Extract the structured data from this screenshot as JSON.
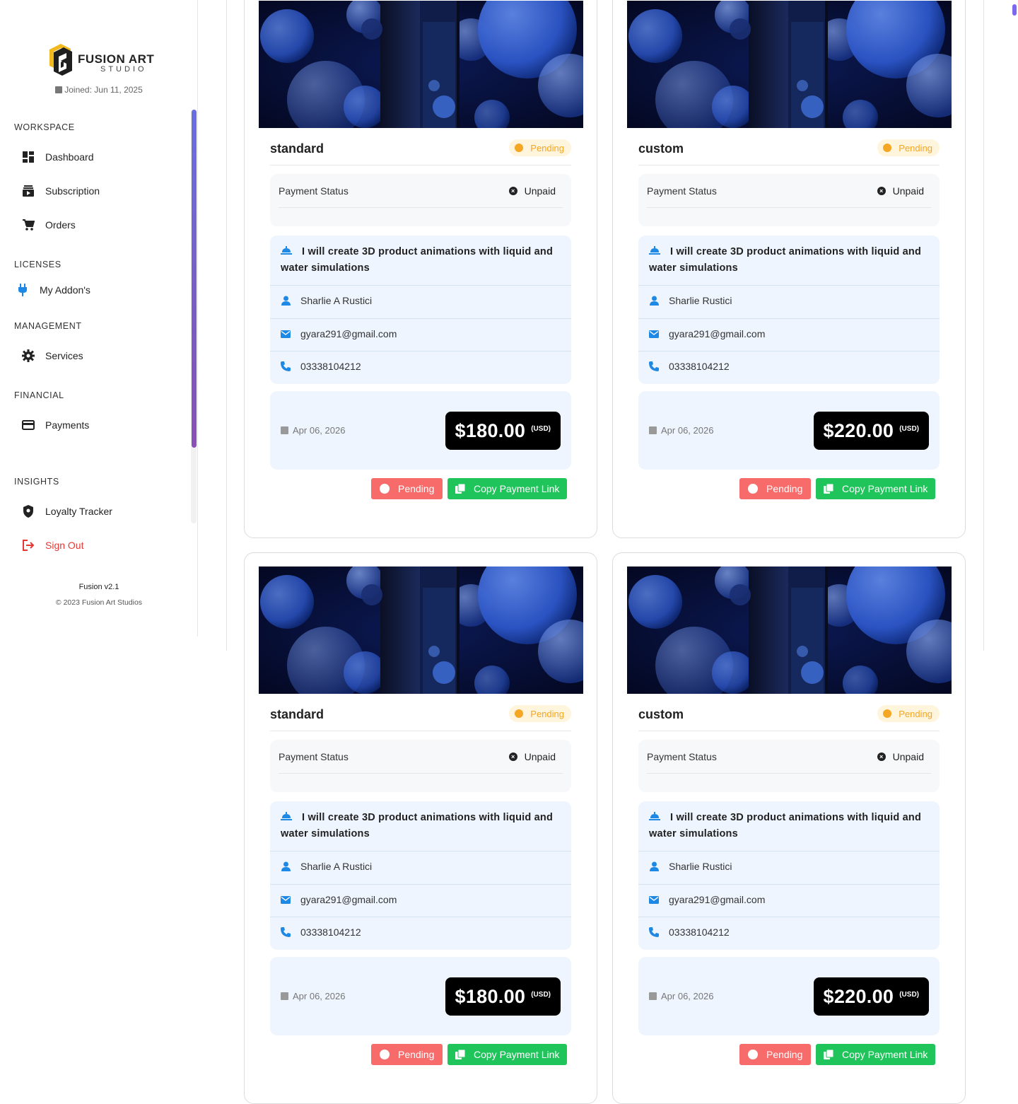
{
  "brand": {
    "name_line1": "FUSION ART",
    "name_line2": "STUDIO",
    "joined": "Joined: Jun 11, 2025"
  },
  "sidebar": {
    "sections": {
      "workspace": "WORKSPACE",
      "licenses": "LICENSES",
      "management": "MANAGEMENT",
      "financial": "FINANCIAL",
      "insights": "INSIGHTS"
    },
    "items": {
      "dashboard": "Dashboard",
      "subscription": "Subscription",
      "orders": "Orders",
      "addons": "My Addon's",
      "services": "Services",
      "payments": "Payments",
      "loyalty": "Loyalty Tracker",
      "signout": "Sign Out"
    },
    "footer": {
      "version": "Fusion v2.1",
      "copyright": "© 2023 Fusion Art Studios"
    }
  },
  "orders": [
    {
      "title": "standard",
      "status": "Pending",
      "payment_status_label": "Payment Status",
      "payment_status": "Unpaid",
      "service": "I will create 3D product animations with liquid and water simulations",
      "customer": "Sharlie A Rustici",
      "email": "gyara291@gmail.com",
      "phone": "03338104212",
      "date": "Apr 06, 2026",
      "price": "$180.00",
      "currency": "(USD)",
      "pending_button": "Pending",
      "copy_button": "Copy Payment Link"
    },
    {
      "title": "custom",
      "status": "Pending",
      "payment_status_label": "Payment Status",
      "payment_status": "Unpaid",
      "service": "I will create 3D product animations with liquid and water simulations",
      "customer": "Sharlie Rustici",
      "email": "gyara291@gmail.com",
      "phone": "03338104212",
      "date": "Apr 06, 2026",
      "price": "$220.00",
      "currency": "(USD)",
      "pending_button": "Pending",
      "copy_button": "Copy Payment Link"
    }
  ],
  "colors": {
    "accent": "#0d6efd",
    "pending": "#f5a623",
    "danger": "#f76b6b",
    "success": "#1fc55a"
  }
}
